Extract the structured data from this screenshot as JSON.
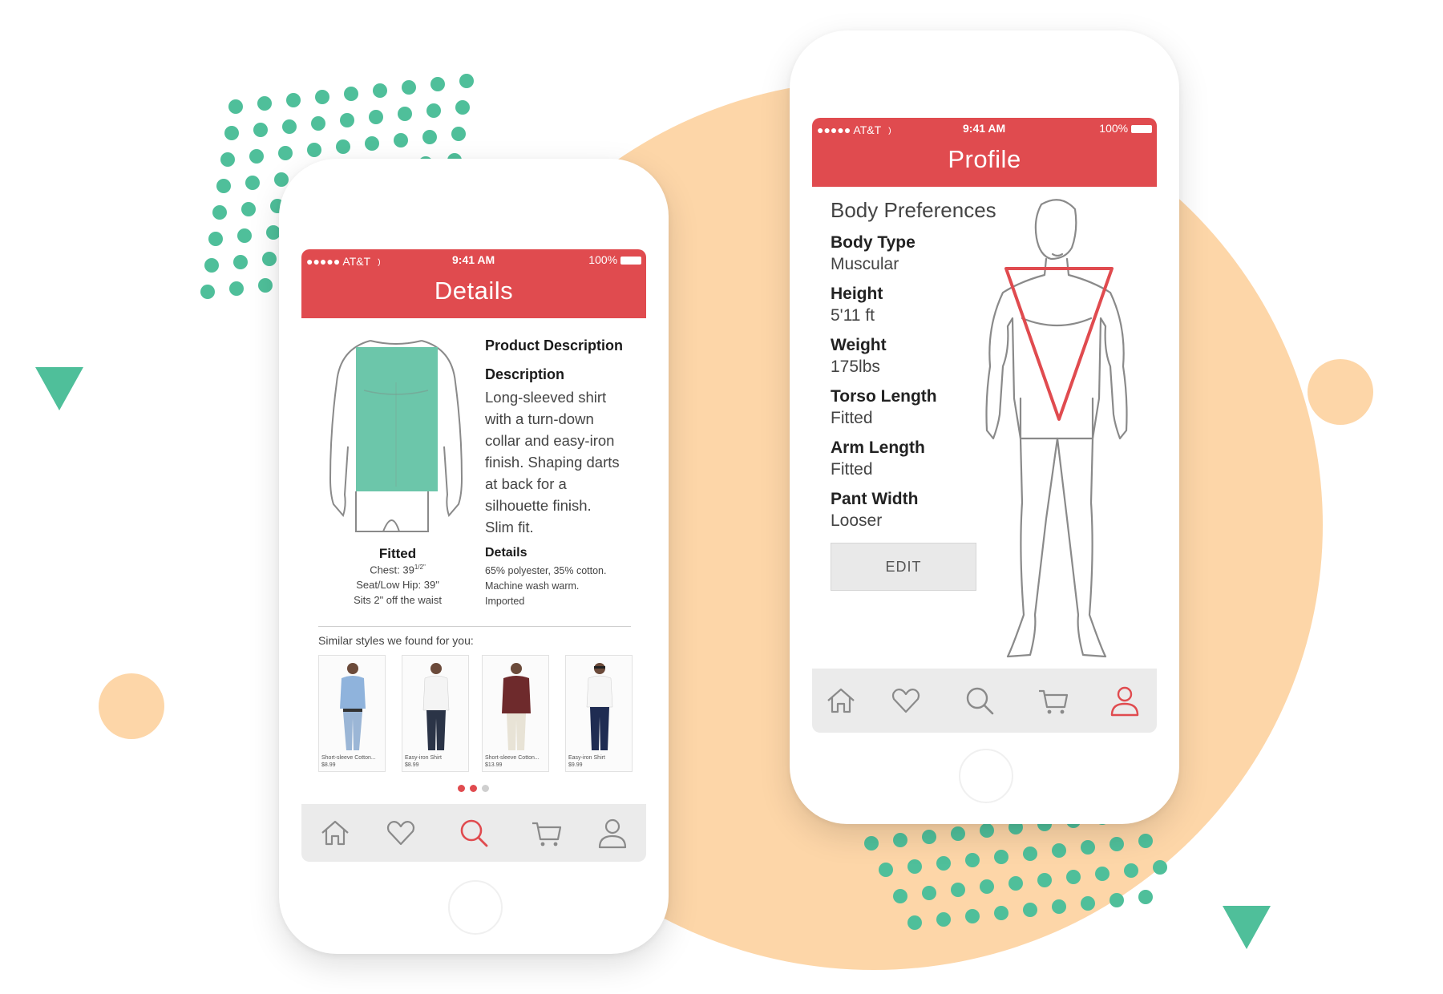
{
  "colors": {
    "brand_red": "#e04b4f",
    "teal": "#4fbf9a",
    "peach": "#fdd6a8",
    "gray_text": "#444444"
  },
  "statusbar": {
    "carrier": "AT&T",
    "time": "9:41 AM",
    "battery": "100%"
  },
  "details_screen": {
    "title": "Details",
    "product_heading": "Product Description",
    "description_heading": "Description",
    "description_lines": [
      "Long-sleeved shirt",
      "with a turn-down",
      "collar and easy-iron",
      "finish. Shaping darts",
      "at back for a",
      "silhouette finish.",
      "Slim fit."
    ],
    "fit_label": "Fitted",
    "fit_chest": "Chest: 39",
    "fit_chest_sup": "1/2\"",
    "fit_seat": "Seat/Low Hip: 39\"",
    "fit_waist": "Sits 2\" off the waist",
    "details_heading": "Details",
    "details_lines": [
      "65% polyester, 35% cotton.",
      "Machine wash warm.",
      "Imported"
    ],
    "similar_label": "Similar styles we found for you:",
    "similar_items": [
      {
        "name": "Short-sleeve Cotton...",
        "price": "$8.99"
      },
      {
        "name": "Easy-iron Shirt",
        "price": "$8.99"
      },
      {
        "name": "Short-sleeve Cotton...",
        "price": "$13.99"
      },
      {
        "name": "Easy-iron Shirt",
        "price": "$9.99"
      }
    ],
    "page_dots": {
      "count": 3,
      "active": 0
    },
    "active_tab": "search"
  },
  "profile_screen": {
    "title": "Profile",
    "section_heading": "Body Preferences",
    "fields": [
      {
        "label": "Body Type",
        "value": "Muscular"
      },
      {
        "label": "Height",
        "value": "5'11 ft"
      },
      {
        "label": "Weight",
        "value": "175lbs"
      },
      {
        "label": "Torso Length",
        "value": "Fitted"
      },
      {
        "label": "Arm Length",
        "value": "Fitted"
      },
      {
        "label": "Pant Width",
        "value": "Looser"
      }
    ],
    "edit_button": "EDIT",
    "active_tab": "profile"
  },
  "tabs": [
    "home-icon",
    "heart-icon",
    "search-icon",
    "cart-icon",
    "user-icon"
  ]
}
